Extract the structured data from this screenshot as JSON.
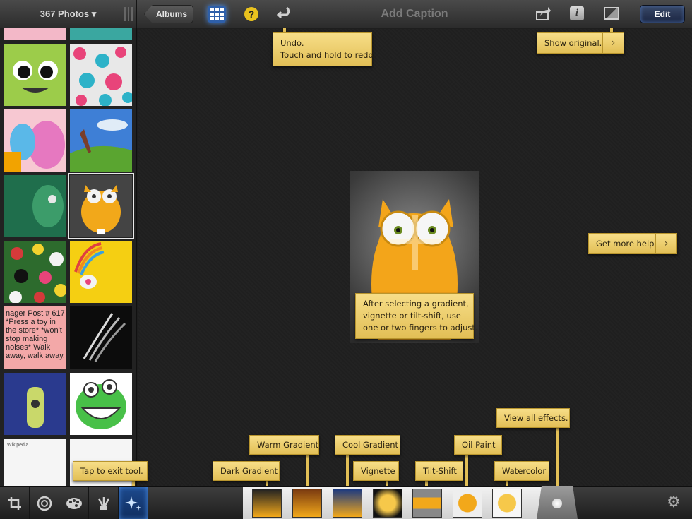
{
  "topbar": {
    "photos_count": "367 Photos ▾",
    "albums_label": "Albums",
    "help_label": "?",
    "caption_placeholder": "Add Caption",
    "edit_label": "Edit",
    "info_label": "i"
  },
  "tooltips": {
    "undo_line1": "Undo.",
    "undo_line2": "Touch and hold to redo.",
    "show_original": "Show original.",
    "get_more_help": "Get more help.",
    "gradient_line1": "After selecting a gradient,",
    "gradient_line2": "vignette or tilt-shift, use",
    "gradient_line3": "one or two fingers to adjust.",
    "view_all_effects": "View all effects.",
    "warm_gradient": "Warm Gradient",
    "cool_gradient": "Cool Gradient",
    "oil_paint": "Oil Paint",
    "dark_gradient": "Dark Gradient",
    "vignette": "Vignette",
    "tilt_shift": "Tilt-Shift",
    "watercolor": "Watercolor",
    "exit_tool": "Tap to exit tool."
  },
  "sidebar": {
    "thumb_post_text": "nager Post # 617 *Press a toy in the store* *won't stop making noises* Walk away, walk away.",
    "thumb_doc_text": "Wikipedia"
  },
  "colors": {
    "tooltip_bg": "#f0d070",
    "accent_blue": "#2e5fa9",
    "help_yellow": "#e9c21e"
  },
  "icons": {
    "undo": "undo-icon",
    "grid": "grid-icon",
    "share": "share-icon",
    "info": "info-icon",
    "compare": "compare-icon",
    "crop": "crop-icon",
    "exposure": "aperture-icon",
    "color": "palette-icon",
    "brushes": "brushes-icon",
    "effects": "sparkle-icon",
    "settings": "gear-icon"
  }
}
